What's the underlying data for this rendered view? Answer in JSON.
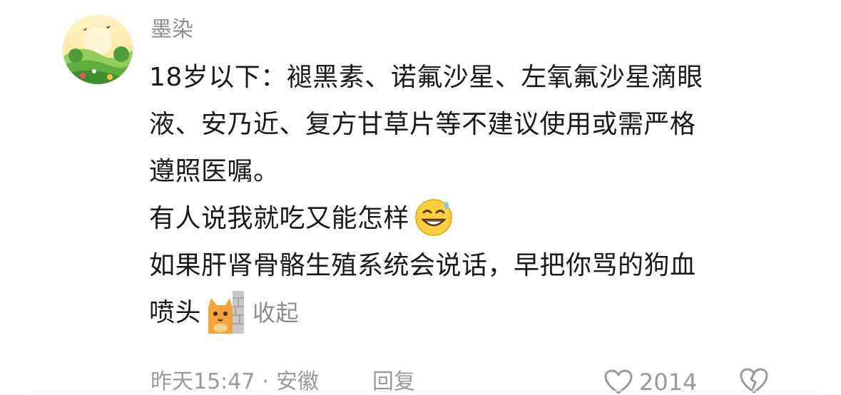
{
  "comment": {
    "author": "墨染",
    "lines": [
      "18岁以下：褪黑素、诺氟沙星、左氧氟沙星滴眼",
      "液、安乃近、复方甘草片等不建议使用或需严格",
      "遵照医嘱。",
      "有人说我就吃又能怎样",
      "如果肝肾骨骼生殖系统会说话，早把你骂的狗血",
      "喷头"
    ],
    "collapse_label": "收起",
    "emoji_1": "grinning-sweat-emoji",
    "emoji_2": "cat-peeking-wall-emoji"
  },
  "footer": {
    "time": "昨天15:47",
    "separator": "·",
    "location": "安徽",
    "reply_label": "回复",
    "like_count": "2014"
  },
  "colors": {
    "text": "#1a1a1a",
    "muted": "#8d8d8d"
  }
}
